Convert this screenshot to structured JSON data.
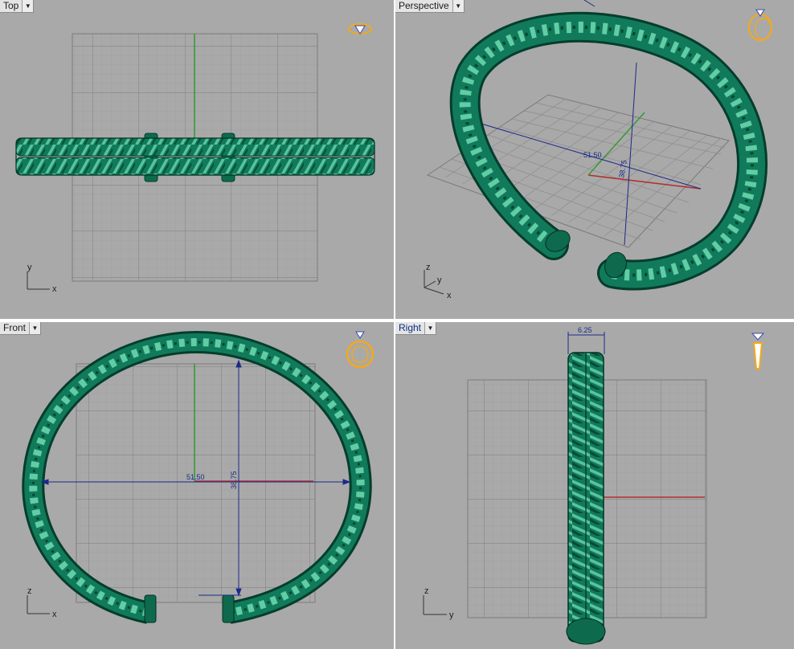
{
  "viewports": {
    "top": {
      "label": "Top",
      "axis_a": "y",
      "axis_b": "x"
    },
    "perspective": {
      "label": "Perspective",
      "axis_z": "z",
      "axis_y": "y",
      "axis_x": "x",
      "dim_width": "51.50",
      "dim_height": "38.75"
    },
    "front": {
      "label": "Front",
      "axis_a": "z",
      "axis_b": "x",
      "dim_width": "51.50",
      "dim_height": "38.75"
    },
    "right": {
      "label": "Right",
      "axis_a": "z",
      "axis_b": "y",
      "dim_thickness": "6.25"
    }
  },
  "icons": {
    "dropdown": "dropdown-arrow-icon",
    "ring_gem": "ring-gem-icon"
  },
  "colors": {
    "viewport_bg": "#a9a9a9",
    "grid": "#8c8c8c",
    "ring_green": "#117a5a",
    "ring_light": "#5fd0a8",
    "ring_dark": "#053d2c",
    "dimension": "#1b2a8a",
    "x_axis": "#b23030",
    "y_axis": "#2f9a2f",
    "icon_orange": "#f2a91e"
  }
}
